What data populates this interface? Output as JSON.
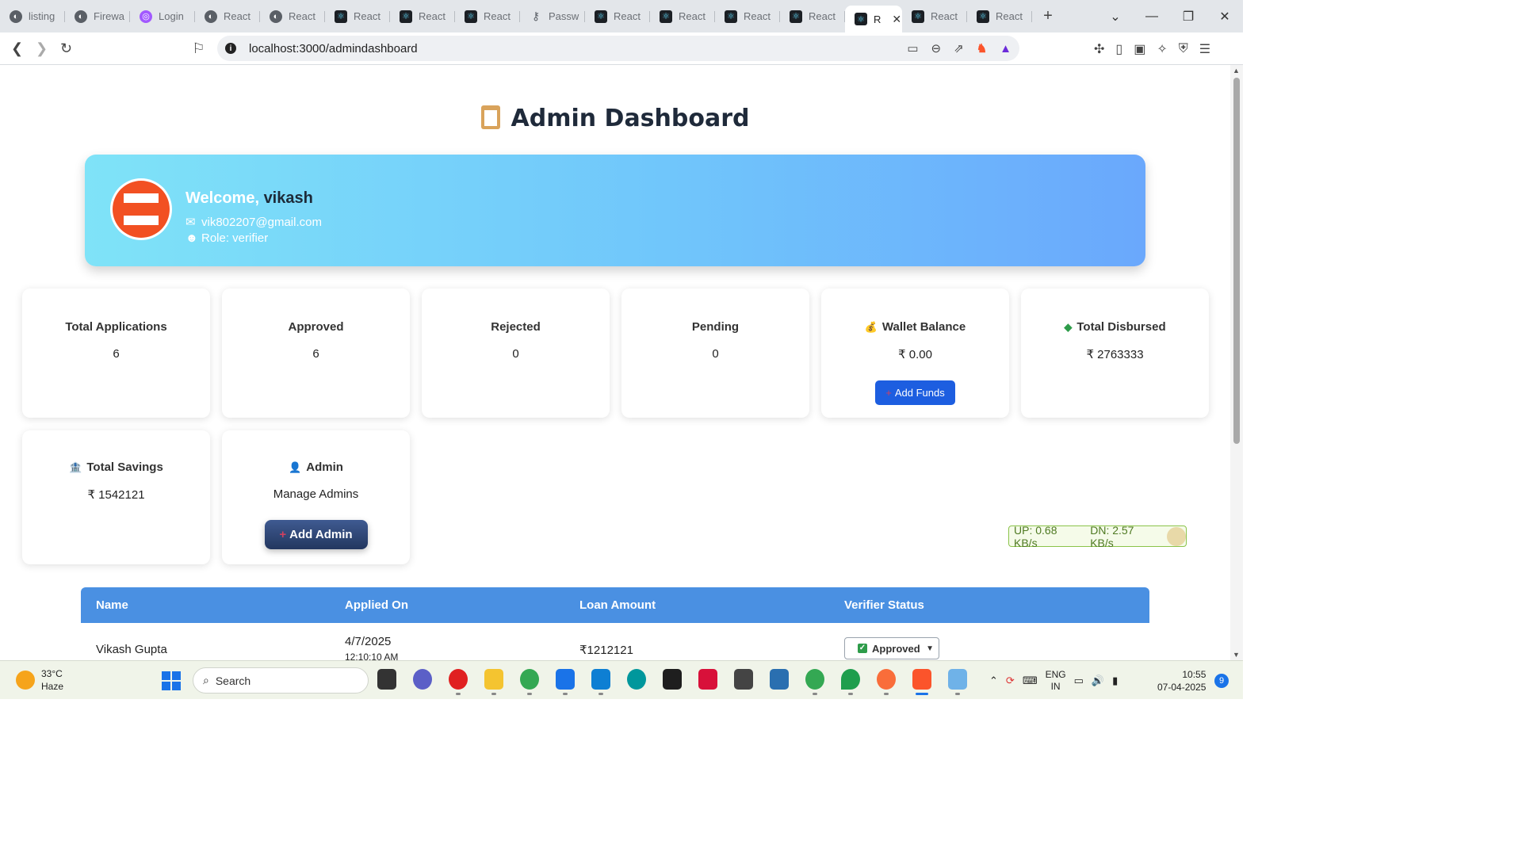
{
  "browser": {
    "tabs": [
      {
        "label": "listing",
        "icon": "globe-icon"
      },
      {
        "label": "Firewa",
        "icon": "globe-icon"
      },
      {
        "label": "Login",
        "icon": "figma-icon"
      },
      {
        "label": "React",
        "icon": "globe-icon"
      },
      {
        "label": "React",
        "icon": "globe-icon"
      },
      {
        "label": "React",
        "icon": "react-icon"
      },
      {
        "label": "React",
        "icon": "react-icon"
      },
      {
        "label": "React",
        "icon": "react-icon"
      },
      {
        "label": "Passw",
        "icon": "key-icon"
      },
      {
        "label": "React",
        "icon": "react-icon"
      },
      {
        "label": "React",
        "icon": "react-icon"
      },
      {
        "label": "React",
        "icon": "react-icon"
      },
      {
        "label": "React",
        "icon": "react-icon"
      },
      {
        "label": "R",
        "icon": "react-icon",
        "active": true
      },
      {
        "label": "React",
        "icon": "react-icon"
      },
      {
        "label": "React",
        "icon": "react-icon"
      }
    ],
    "url": "localhost:3000/admindashboard"
  },
  "page": {
    "title": "Admin Dashboard",
    "welcome": {
      "greeting": "Welcome,",
      "name": "vikash",
      "email": "vik802207@gmail.com",
      "role": "Role: verifier"
    },
    "cards": {
      "total_applications": {
        "title": "Total Applications",
        "value": "6"
      },
      "approved": {
        "title": "Approved",
        "value": "6"
      },
      "rejected": {
        "title": "Rejected",
        "value": "0"
      },
      "pending": {
        "title": "Pending",
        "value": "0"
      },
      "wallet": {
        "title": "Wallet Balance",
        "value": "₹ 0.00",
        "button": "Add Funds"
      },
      "disbursed": {
        "title": "Total Disbursed",
        "value": "₹ 2763333"
      },
      "savings": {
        "title": "Total Savings",
        "value": "₹ 1542121"
      },
      "admin": {
        "title": "Admin",
        "value": "Manage Admins",
        "button": "Add Admin"
      }
    },
    "netmon": {
      "up": "UP: 0.68 KB/s",
      "down": "DN: 2.57 KB/s"
    },
    "table": {
      "headers": [
        "Name",
        "Applied On",
        "Loan Amount",
        "Verifier Status"
      ],
      "rows": [
        {
          "name": "Vikash Gupta",
          "applied_date": "4/7/2025",
          "applied_time": "12:10:10 AM",
          "amount": "₹1212121",
          "status": "Approved"
        }
      ]
    }
  },
  "taskbar": {
    "weather_temp": "33°C",
    "weather_desc": "Haze",
    "search_placeholder": "Search",
    "lang_top": "ENG",
    "lang_bottom": "IN",
    "time": "10:55",
    "date": "07-04-2025",
    "notifications": "9"
  },
  "colors": {
    "accent_blue": "#4a90e2",
    "button_blue": "#1d5ee0",
    "avatar_orange": "#f25022"
  }
}
